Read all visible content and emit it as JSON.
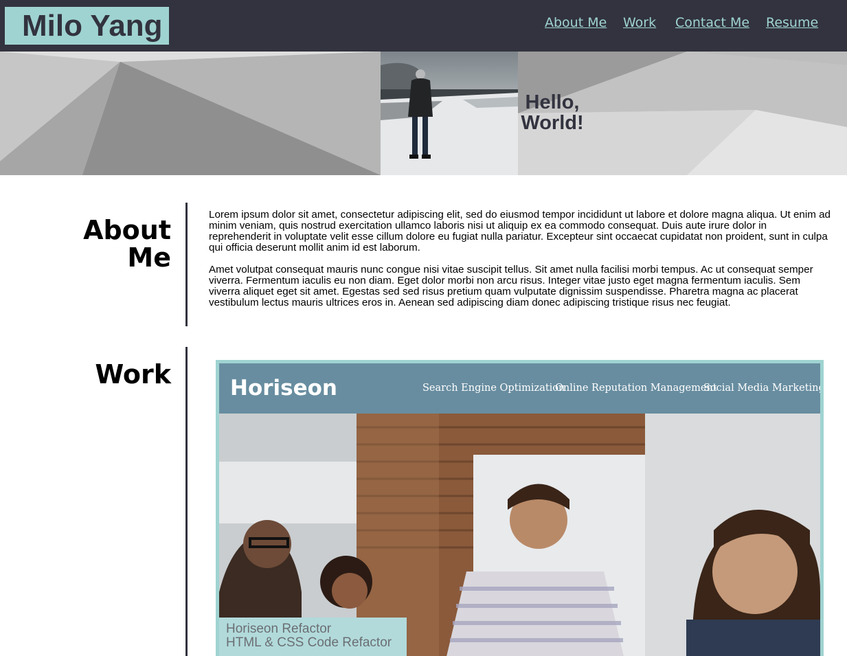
{
  "header": {
    "logo": "Milo Yang",
    "nav": [
      {
        "label": "About Me"
      },
      {
        "label": "Work"
      },
      {
        "label": "Contact Me"
      },
      {
        "label": "Resume"
      }
    ]
  },
  "hero": {
    "greeting_line1": "Hello,",
    "greeting_line2": "World!"
  },
  "about": {
    "title_line1": "About",
    "title_line2": "Me",
    "paragraphs": [
      "Lorem ipsum dolor sit amet, consectetur adipiscing elit, sed do eiusmod tempor incididunt ut labore et dolore magna aliqua. Ut enim ad minim veniam, quis nostrud exercitation ullamco laboris nisi ut aliquip ex ea commodo consequat. Duis aute irure dolor in reprehenderit in voluptate velit esse cillum dolore eu fugiat nulla pariatur. Excepteur sint occaecat cupidatat non proident, sunt in culpa qui officia deserunt mollit anim id est laborum.",
      "Amet volutpat consequat mauris nunc congue nisi vitae suscipit tellus. Sit amet nulla facilisi morbi tempus. Ac ut consequat semper viverra. Fermentum iaculis eu non diam. Eget dolor morbi non arcu risus. Integer vitae justo eget magna fermentum iaculis. Sem viverra aliquet eget sit amet. Egestas sed sed risus pretium quam vulputate dignissim suspendisse. Pharetra magna ac placerat vestibulum lectus mauris ultrices eros in. Aenean sed adipiscing diam donec adipiscing tristique risus nec feugiat."
    ]
  },
  "work": {
    "title": "Work",
    "project": {
      "site_logo": "Horiseon",
      "site_links": [
        "Search Engine Optimization",
        "Online Reputation Management",
        "Social Media Marketing"
      ],
      "caption_title": "Horiseon Refactor",
      "caption_subtitle": "HTML & CSS Code Refactor"
    }
  },
  "colors": {
    "header_bg": "#32333f",
    "accent": "#9fd3d1",
    "caption_bg": "#b2dadb",
    "site_nav_bg": "#688da0"
  }
}
